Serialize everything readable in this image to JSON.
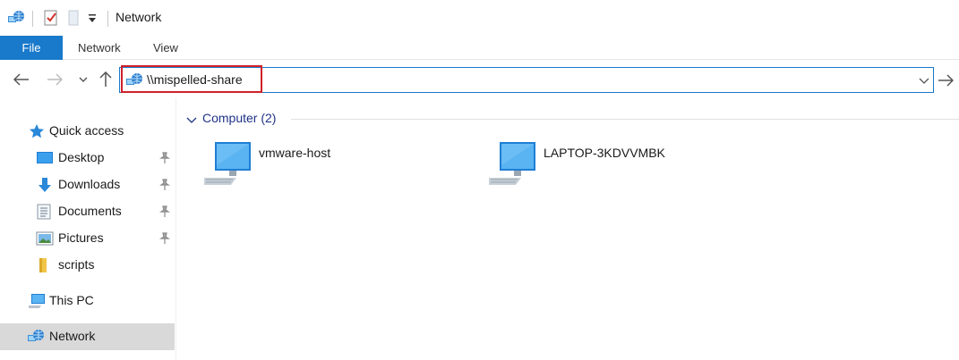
{
  "window": {
    "title": "Network"
  },
  "quick_access_toolbar": {
    "icons": [
      "network-icon",
      "properties-icon",
      "new-folder-icon",
      "customize-dropdown-icon"
    ]
  },
  "ribbon": {
    "tabs": [
      {
        "label": "File",
        "active": true
      },
      {
        "label": "Network"
      },
      {
        "label": "View"
      }
    ]
  },
  "address_bar": {
    "path": "\\\\mispelled-share",
    "icon": "network-icon"
  },
  "sidebar": {
    "quick_access": {
      "label": "Quick access"
    },
    "items": [
      {
        "label": "Desktop",
        "icon": "desktop-icon",
        "pinned": true
      },
      {
        "label": "Downloads",
        "icon": "downloads-icon",
        "pinned": true
      },
      {
        "label": "Documents",
        "icon": "documents-icon",
        "pinned": true
      },
      {
        "label": "Pictures",
        "icon": "pictures-icon",
        "pinned": true
      },
      {
        "label": "scripts",
        "icon": "folder-icon",
        "pinned": false
      }
    ],
    "this_pc": {
      "label": "This PC"
    },
    "network": {
      "label": "Network",
      "selected": true
    }
  },
  "content": {
    "group": {
      "label": "Computer (2)"
    },
    "computers": [
      {
        "name": "vmware-host",
        "icon": "computer-icon"
      },
      {
        "name": "LAPTOP-3KDVVMBK",
        "icon": "computer-icon"
      }
    ]
  },
  "colors": {
    "accent": "#1979ca",
    "highlight_border": "#d0212b",
    "group_text": "#1e3287",
    "selected_bg": "#d9d9d9"
  }
}
